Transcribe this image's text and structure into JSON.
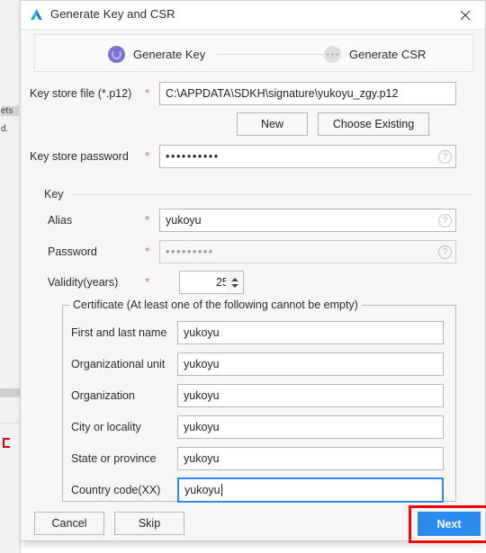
{
  "window": {
    "title": "Generate Key and CSR",
    "app_icon": "android-studio-logo-icon",
    "close_icon": "close-icon"
  },
  "stepper": {
    "steps": [
      {
        "label": "Generate Key",
        "state": "active",
        "icon": "spinner-circle-icon"
      },
      {
        "label": "Generate CSR",
        "state": "pending",
        "icon": "ellipsis-circle-icon"
      }
    ]
  },
  "keystore": {
    "file_label": "Key store file (*.p12)",
    "file_required": "*",
    "file_value": "C:\\APPDATA\\SDKH\\signature\\yukoyu_zgy.p12",
    "new_button": "New",
    "choose_existing_button": "Choose Existing",
    "password_label": "Key store password",
    "password_required": "*",
    "password_value": "••••••••••",
    "password_help": "?"
  },
  "key_group": {
    "title": "Key",
    "alias_label": "Alias",
    "alias_required": "*",
    "alias_value": "yukoyu",
    "alias_help": "?",
    "password_label": "Password",
    "password_required": "*",
    "password_value": "•••••••••",
    "password_help": "?",
    "validity_label": "Validity(years)",
    "validity_required": "*",
    "validity_value": "25"
  },
  "certificate": {
    "legend": "Certificate (At least one of the following cannot be empty)",
    "fields": [
      {
        "label": "First and last name",
        "value": "yukoyu",
        "focused": false
      },
      {
        "label": "Organizational unit",
        "value": "yukoyu",
        "focused": false
      },
      {
        "label": "Organization",
        "value": "yukoyu",
        "focused": false
      },
      {
        "label": "City or locality",
        "value": "yukoyu",
        "focused": false
      },
      {
        "label": "State or province",
        "value": "yukoyu",
        "focused": false
      },
      {
        "label": "Country code(XX)",
        "value": "yukoyu",
        "focused": true
      }
    ]
  },
  "footer": {
    "cancel_button": "Cancel",
    "skip_button": "Skip",
    "next_button": "Next"
  },
  "annotation": {
    "highlight_target": "next-button",
    "highlight_color": "#ff0000"
  },
  "background": {
    "fragments": [
      "ets",
      "d."
    ]
  },
  "colors": {
    "accent_blue": "#2a8bec",
    "step_active_purple": "#7b72d0",
    "required_red": "#d66a6a",
    "annotation_red": "#ff0000",
    "dialog_bg": "#f6f6f6"
  }
}
